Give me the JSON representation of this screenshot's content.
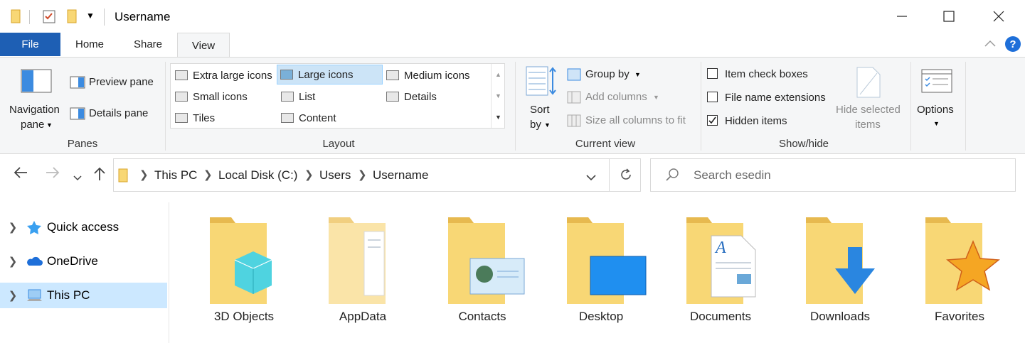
{
  "window": {
    "title": "Username"
  },
  "ribbon_tabs": [
    "File",
    "Home",
    "Share",
    "View"
  ],
  "panes": {
    "navigation_pane": "Navigation",
    "navigation_pane_2": "pane",
    "preview_pane": "Preview pane",
    "details_pane": "Details pane",
    "label": "Panes"
  },
  "layout": {
    "items": [
      "Extra large icons",
      "Large icons",
      "Medium icons",
      "Small icons",
      "List",
      "Details",
      "Tiles",
      "Content"
    ],
    "selected": "Large icons",
    "label": "Layout"
  },
  "current_view": {
    "sort_by": "Sort",
    "sort_by_2": "by",
    "group_by": "Group by",
    "add_columns": "Add columns",
    "size_all_columns": "Size all columns to fit",
    "label": "Current view"
  },
  "show_hide": {
    "item_check_boxes": "Item check boxes",
    "file_name_extensions": "File name extensions",
    "hidden_items": "Hidden items",
    "hide_selected": "Hide selected",
    "hide_selected_2": "items",
    "label": "Show/hide",
    "checked": {
      "item_check_boxes": false,
      "file_name_extensions": false,
      "hidden_items": true
    }
  },
  "options": {
    "label": "Options"
  },
  "address": {
    "crumbs": [
      "This PC",
      "Local Disk (C:)",
      "Users",
      "Username"
    ]
  },
  "search": {
    "placeholder": "Search esedin"
  },
  "nav": {
    "items": [
      "Quick access",
      "OneDrive",
      "This PC"
    ],
    "selected": "This PC"
  },
  "folders": [
    "3D Objects",
    "AppData",
    "Contacts",
    "Desktop",
    "Documents",
    "Downloads",
    "Favorites"
  ],
  "colors": {
    "accent": "#1e5fb4",
    "selection": "#cce8ff",
    "folder": "#f8d775",
    "help": "#1e6fd9"
  }
}
